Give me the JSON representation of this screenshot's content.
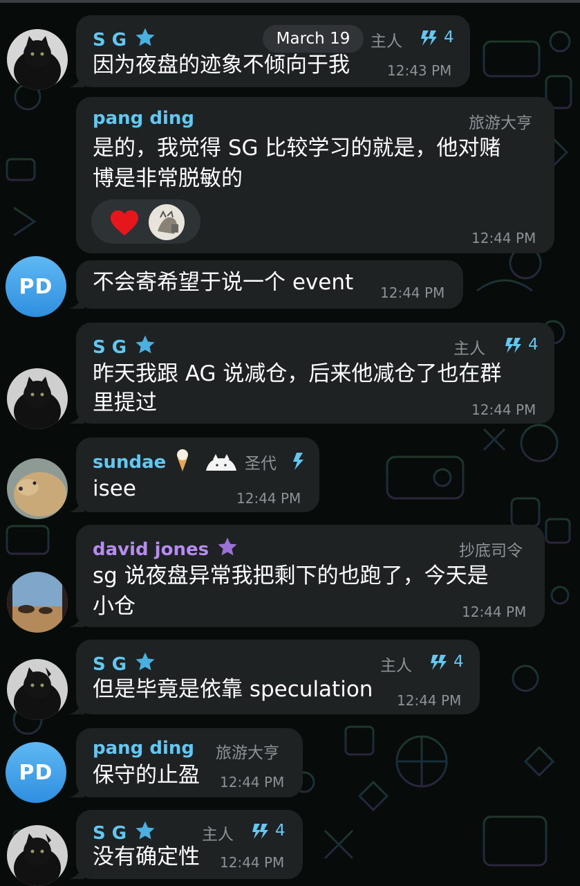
{
  "date_separator": "March 19",
  "messages": [
    {
      "sender": "S G",
      "role": "主人",
      "boost": "4",
      "lines": [
        "因为夜盘的迹象不倾向于我"
      ],
      "time": "12:43 PM"
    },
    {
      "sender": "pang ding",
      "role": "旅游大亨",
      "lines": [
        "是的，我觉得 SG 比较学习的就是，他对赌",
        "博是非常脱敏的"
      ],
      "reactions": [
        "heart",
        "custom-sticker"
      ],
      "time": "12:44 PM"
    },
    {
      "avatar_initials": "PD",
      "lines": [
        "不会寄希望于说一个 event"
      ],
      "time": "12:44 PM"
    },
    {
      "sender": "S G",
      "role": "主人",
      "boost": "4",
      "lines": [
        "昨天我跟 AG 说减仓，后来他减仓了也在群",
        "里提过"
      ],
      "time": "12:44 PM"
    },
    {
      "sender": "sundae",
      "role": "圣代",
      "lines": [
        "isee"
      ],
      "time": "12:44 PM"
    },
    {
      "sender": "david jones",
      "role": "抄底司令",
      "lines": [
        "sg 说夜盘异常我把剩下的也跑了，今天是",
        "小仓"
      ],
      "time": "12:44 PM"
    },
    {
      "sender": "S G",
      "role": "主人",
      "boost": "4",
      "lines": [
        "但是毕竟是依靠 speculation"
      ],
      "time": "12:44 PM"
    },
    {
      "sender": "pang ding",
      "role": "旅游大亨",
      "avatar_initials": "PD",
      "lines": [
        "保守的止盈"
      ],
      "time": "12:44 PM"
    },
    {
      "sender": "S G",
      "role": "主人",
      "boost": "4",
      "lines": [
        "没有确定性"
      ],
      "time": "12:44 PM"
    }
  ],
  "colors": {
    "background": "#070b0a",
    "bubble": "#1e2223",
    "name_cyan": "#63c7f2",
    "name_purple": "#b78cf0",
    "meta_gray": "#8c9296",
    "avatar_blue": "#3b9be6"
  },
  "icons": [
    "star-icon",
    "boost-icon",
    "heart-icon",
    "ice-cream-icon",
    "cat-emoji-icon"
  ]
}
